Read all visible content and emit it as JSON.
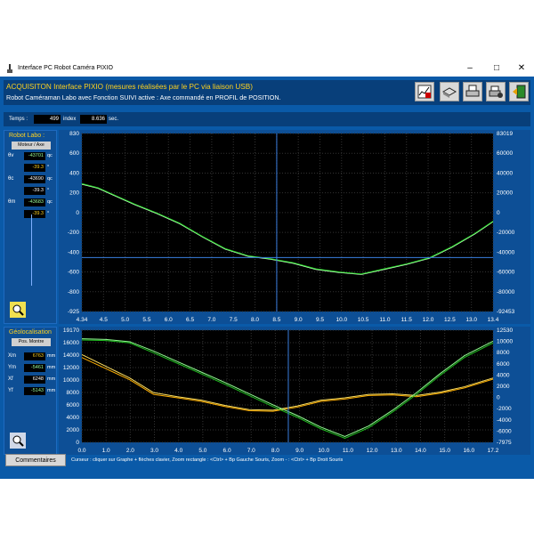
{
  "window": {
    "title": "Interface PC Robot Caméra PIXIO",
    "controls": [
      "minimize",
      "maximize",
      "close"
    ]
  },
  "header": {
    "line1": "ACQUISITON Interface PIXIO (mesures réalisées par le PC via liaison USB)",
    "line2": "Robot Caméraman Labo avec Fonction SUIVI active : Axe commandé en PROFIL de POSITION."
  },
  "toolbar": {
    "icons": [
      "chart-settings-icon",
      "open-icon",
      "print-icon",
      "print-setup-icon",
      "exit-icon"
    ]
  },
  "info": {
    "temps_label": "Temps :",
    "index_value": "499",
    "index_label": "index",
    "time_value": "8.636",
    "time_unit": "sec."
  },
  "robot": {
    "title": "Robot Labo :",
    "mode_button": "Moteur / Axe",
    "rows": [
      {
        "label": "θv",
        "value": "-43701",
        "unit": "qc",
        "color": "#9bff9b"
      },
      {
        "label": "",
        "value": "-39.3",
        "unit": "°",
        "color": "#ffd21f"
      },
      {
        "label": "θc",
        "value": "-43690",
        "unit": "qc",
        "color": "#ffffff"
      },
      {
        "label": "",
        "value": "-39.3",
        "unit": "°",
        "color": "#ffffff"
      },
      {
        "label": "θm",
        "value": "-43683",
        "unit": "qc",
        "color": "#9bff9b"
      },
      {
        "label": "",
        "value": "-39.3",
        "unit": "°",
        "color": "#ffd21f"
      }
    ]
  },
  "geo": {
    "title": "Géolocalisation",
    "mode_button": "Pos. Montre",
    "rows": [
      {
        "label": "Xm",
        "value": "6763",
        "unit": "mm",
        "color": "#ffd21f"
      },
      {
        "label": "Ym",
        "value": "-5461",
        "unit": "mm",
        "color": "#9bff9b"
      },
      {
        "label": "Xf",
        "value": "6248",
        "unit": "mm",
        "color": "#ffffff"
      },
      {
        "label": "Yf",
        "value": "-5143",
        "unit": "mm",
        "color": "#9bff9b"
      }
    ]
  },
  "status": {
    "button": "Commentaires",
    "text": "Curseur : cliquer sur Graphe + flèches clavier, Zoom rectangle : <Ctrl> + Bp Gauche Souris, Zoom - : <Ctrl> + Bp Droit Souris"
  },
  "chart_data": [
    {
      "type": "line",
      "title": "",
      "xlim": [
        4.345,
        13.4
      ],
      "x_tick_labels": [
        "4.34",
        "4.5",
        "5.0",
        "5.5",
        "6.0",
        "6.5",
        "7.0",
        "7.5",
        "8.0",
        "8.5",
        "9.0",
        "9.5",
        "10.0",
        "10.5",
        "11.0",
        "11.5",
        "12.0",
        "12.5",
        "13.0",
        "13.4"
      ],
      "y_left_ticks": [
        "830",
        "600",
        "400",
        "200",
        "0",
        "-200",
        "-400",
        "-600",
        "-800",
        "-925"
      ],
      "y_right_ticks": [
        "83019",
        "60000",
        "40000",
        "20000",
        "0",
        "-20000",
        "-40000",
        "-60000",
        "-80000",
        "-92453"
      ],
      "ylim": [
        -925,
        830
      ],
      "cursor_x": 8.636,
      "cursor_y": -393,
      "grid": true,
      "series": [
        {
          "color": "#d0ffd0",
          "x": [
            4.345,
            4.7,
            5.0,
            5.5,
            6.0,
            6.5,
            7.0,
            7.5,
            8.0,
            8.5,
            9.0,
            9.5,
            10.0,
            10.5,
            11.0,
            11.5,
            12.0,
            12.5,
            13.0,
            13.4
          ],
          "values": [
            330,
            290,
            230,
            130,
            40,
            -60,
            -190,
            -310,
            -380,
            -410,
            -450,
            -510,
            -540,
            -560,
            -510,
            -460,
            -400,
            -290,
            -160,
            -40
          ]
        },
        {
          "color": "#30e030",
          "x": [
            4.345,
            4.7,
            5.0,
            5.5,
            6.0,
            6.5,
            7.0,
            7.5,
            8.0,
            8.5,
            9.0,
            9.5,
            10.0,
            10.5,
            11.0,
            11.5,
            12.0,
            12.5,
            13.0,
            13.4
          ],
          "values": [
            335,
            295,
            235,
            135,
            45,
            -55,
            -185,
            -305,
            -375,
            -405,
            -445,
            -505,
            -535,
            -555,
            -505,
            -455,
            -395,
            -285,
            -155,
            -35
          ]
        }
      ]
    },
    {
      "type": "line",
      "title": "",
      "xlim": [
        0.0,
        17.2
      ],
      "x_tick_labels": [
        "0.0",
        "1.0",
        "2.0",
        "3.0",
        "4.0",
        "5.0",
        "6.0",
        "7.0",
        "8.0",
        "9.0",
        "10.0",
        "11.0",
        "12.0",
        "13.0",
        "14.0",
        "15.0",
        "16.0",
        "17.2"
      ],
      "y_left_ticks": [
        "19170",
        "16000",
        "14000",
        "12000",
        "10000",
        "8000",
        "6000",
        "4000",
        "2000",
        "0"
      ],
      "y_right_ticks": [
        "12530",
        "10000",
        "8000",
        "6000",
        "4000",
        "2000",
        "0",
        "-2000",
        "-4000",
        "-6000",
        "-7975"
      ],
      "ylim": [
        0,
        19170
      ],
      "cursor_x": 8.636,
      "grid": true,
      "series": [
        {
          "color": "#ffe060",
          "x": [
            0,
            1,
            2,
            3,
            4,
            5,
            6,
            7,
            8,
            9,
            10,
            11,
            12,
            13,
            14,
            15,
            16,
            17.2
          ],
          "values": [
            15000,
            13000,
            11000,
            8500,
            7800,
            7200,
            6300,
            5600,
            5500,
            6200,
            7200,
            7600,
            8200,
            8300,
            8000,
            8600,
            9500,
            11000
          ]
        },
        {
          "color": "#ffb000",
          "x": [
            0,
            1,
            2,
            3,
            4,
            5,
            6,
            7,
            8,
            9,
            10,
            11,
            12,
            13,
            14,
            15,
            16,
            17.2
          ],
          "values": [
            14500,
            12600,
            10700,
            8200,
            7600,
            7000,
            6100,
            5400,
            5300,
            6000,
            7000,
            7400,
            8000,
            8100,
            7800,
            8400,
            9300,
            10800
          ]
        },
        {
          "color": "#90ff90",
          "x": [
            0,
            1,
            2,
            3,
            4,
            5,
            6,
            7,
            8,
            9,
            10,
            11,
            12,
            13,
            14,
            15,
            16,
            17.2
          ],
          "values": [
            17700,
            17600,
            17200,
            15600,
            13800,
            12000,
            10200,
            8300,
            6400,
            4600,
            2600,
            1000,
            2800,
            5500,
            8500,
            11800,
            14800,
            17300
          ]
        },
        {
          "color": "#20c020",
          "x": [
            0,
            1,
            2,
            3,
            4,
            5,
            6,
            7,
            8,
            9,
            10,
            11,
            12,
            13,
            14,
            15,
            16,
            17.2
          ],
          "values": [
            17500,
            17400,
            17000,
            15300,
            13500,
            11700,
            9900,
            8000,
            6100,
            4300,
            2300,
            700,
            2500,
            5200,
            8200,
            11500,
            14500,
            17000
          ]
        }
      ]
    }
  ]
}
